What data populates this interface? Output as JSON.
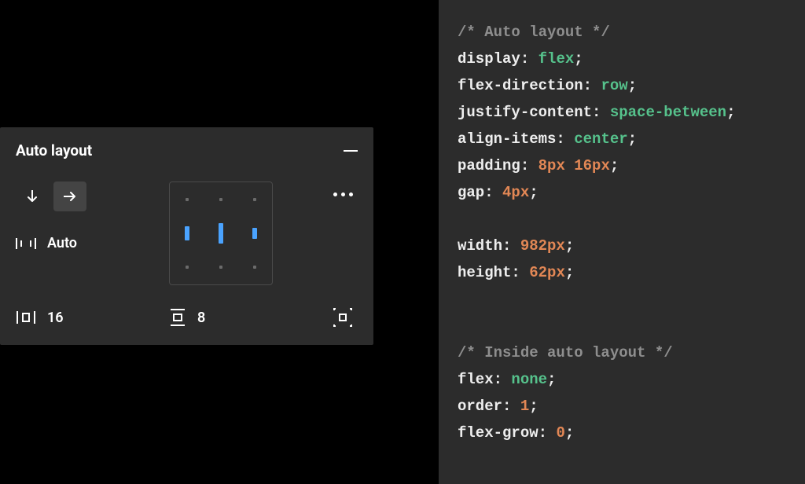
{
  "panel": {
    "title": "Auto layout",
    "direction_selected": "horizontal",
    "spacing_mode": "Auto",
    "horizontal_padding": "16",
    "vertical_padding": "8"
  },
  "code": {
    "comment1": "/* Auto layout */",
    "lines1": [
      {
        "prop": "display",
        "val": "flex",
        "kind": "kw"
      },
      {
        "prop": "flex-direction",
        "val": "row",
        "kind": "kw"
      },
      {
        "prop": "justify-content",
        "val": "space-between",
        "kind": "kw"
      },
      {
        "prop": "align-items",
        "val": "center",
        "kind": "kw"
      },
      {
        "prop": "padding",
        "val": "8px 16px",
        "kind": "num"
      },
      {
        "prop": "gap",
        "val": "4px",
        "kind": "num"
      }
    ],
    "lines2": [
      {
        "prop": "width",
        "val": "982px",
        "kind": "num"
      },
      {
        "prop": "height",
        "val": "62px",
        "kind": "num"
      }
    ],
    "comment2": "/* Inside auto layout */",
    "lines3": [
      {
        "prop": "flex",
        "val": "none",
        "kind": "kw"
      },
      {
        "prop": "order",
        "val": "1",
        "kind": "num"
      },
      {
        "prop": "flex-grow",
        "val": "0",
        "kind": "num"
      }
    ]
  }
}
